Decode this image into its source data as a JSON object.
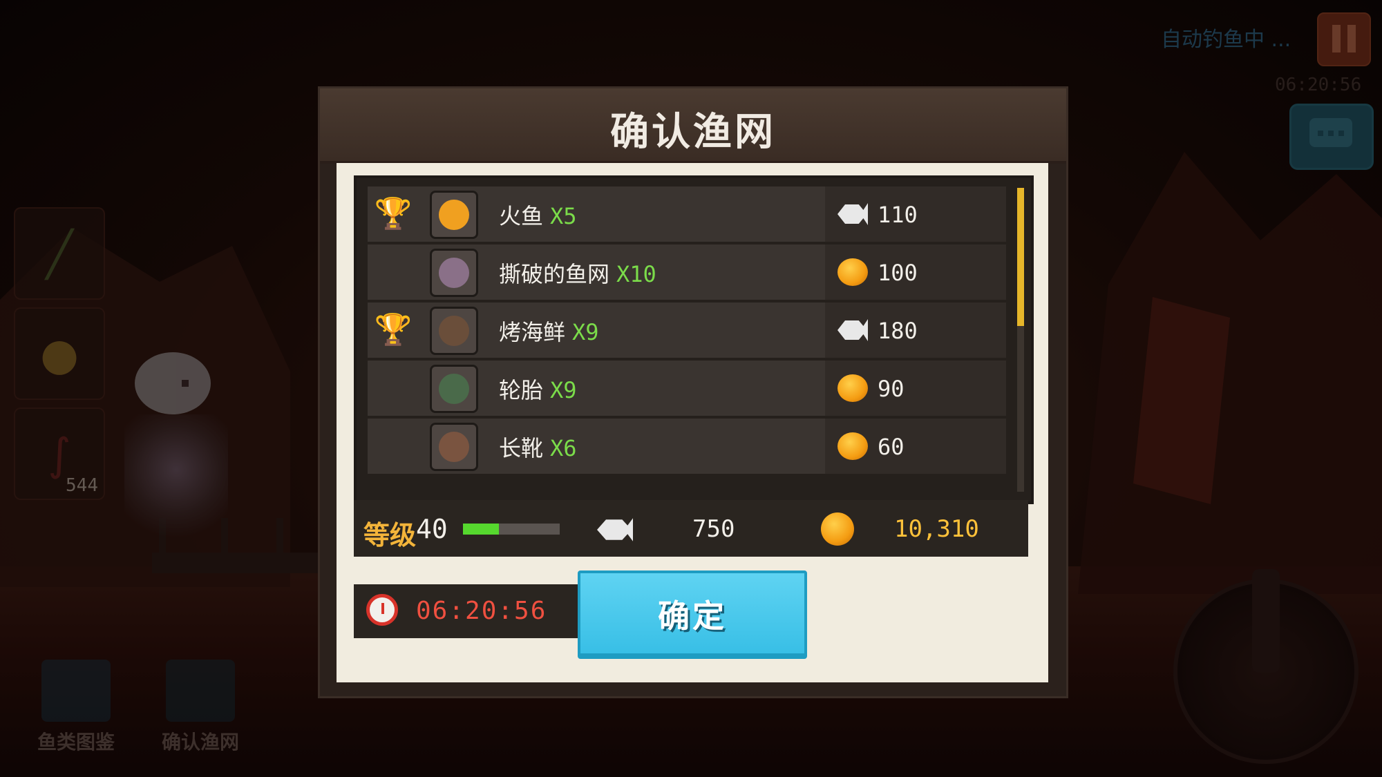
{
  "hud": {
    "auto_fishing": "自动钓鱼中 ...",
    "timer": "06:20:56",
    "side_count": "544"
  },
  "bottom_buttons": [
    {
      "label": "鱼类图鉴",
      "icon": "book-icon"
    },
    {
      "label": "确认渔网",
      "icon": "net-icon"
    }
  ],
  "modal": {
    "title": "确认渔网",
    "items": [
      {
        "name": "火鱼",
        "qty": "X5",
        "trophy": "gold",
        "price_type": "fish",
        "price": "110",
        "icon_color": "#f0a020"
      },
      {
        "name": "撕破的鱼网",
        "qty": "X10",
        "trophy": "",
        "price_type": "coin",
        "price": "100",
        "icon_color": "#8a7088"
      },
      {
        "name": "烤海鲜",
        "qty": "X9",
        "trophy": "silver",
        "price_type": "fish",
        "price": "180",
        "icon_color": "#6a4e3a"
      },
      {
        "name": "轮胎",
        "qty": "X9",
        "trophy": "",
        "price_type": "coin",
        "price": "90",
        "icon_color": "#4a6a4a"
      },
      {
        "name": "长靴",
        "qty": "X6",
        "trophy": "",
        "price_type": "coin",
        "price": "60",
        "icon_color": "#7a5440"
      }
    ],
    "stats": {
      "level_label": "等级",
      "level": "40",
      "xp_fraction": 0.37,
      "fish_total": "750",
      "coin_total": "10,310"
    },
    "timer": "06:20:56",
    "confirm_label": "确定"
  },
  "colors": {
    "accent_button": "#38bfe6",
    "qty_green": "#7bdc4a",
    "level_orange": "#f3b43a",
    "timer_red": "#f05040"
  }
}
